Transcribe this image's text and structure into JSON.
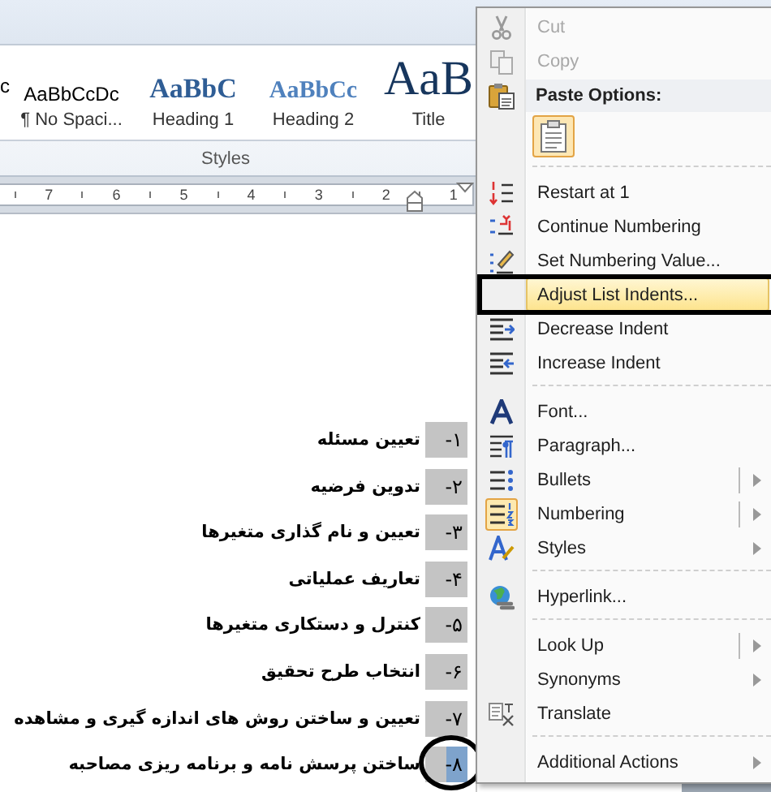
{
  "ribbon": {
    "styles": [
      {
        "sample": "c",
        "kind": "normal"
      },
      {
        "sample": "AaBbCcDc",
        "label": "¶ No Spaci...",
        "kind": "nospacing"
      },
      {
        "sample": "AaBbC",
        "label": "Heading 1",
        "kind": "heading1"
      },
      {
        "sample": "AaBbCc",
        "label": "Heading 2",
        "kind": "heading2"
      },
      {
        "sample": "AaB",
        "label": "Title",
        "kind": "title"
      }
    ],
    "group_label": "Styles"
  },
  "ruler": {
    "marks": [
      "7",
      "6",
      "5",
      "4",
      "3",
      "2",
      "1"
    ]
  },
  "list": [
    {
      "number": "۱-",
      "text": "تعیین مسئله",
      "selected": false,
      "circled": false
    },
    {
      "number": "۲-",
      "text": "تدوین فرضیه",
      "selected": false,
      "circled": false
    },
    {
      "number": "۳-",
      "text": "تعیین و نام گذاری متغیرها",
      "selected": false,
      "circled": false
    },
    {
      "number": "۴-",
      "text": "تعاریف عملیاتی",
      "selected": false,
      "circled": false
    },
    {
      "number": "۵-",
      "text": "کنترل و دستکاری متغیرها",
      "selected": false,
      "circled": false
    },
    {
      "number": "۶-",
      "text": "انتخاب طرح تحقیق",
      "selected": false,
      "circled": false
    },
    {
      "number": "۷-",
      "text": "تعیین و ساختن روش های اندازه گیری و مشاهده",
      "selected": false,
      "circled": false
    },
    {
      "number": "۸-",
      "text": "ساختن پرسش نامه و برنامه ریزی مصاحبه",
      "selected": true,
      "circled": true
    }
  ],
  "context_menu": [
    {
      "kind": "command",
      "label": "Cut",
      "disabled": true
    },
    {
      "kind": "command",
      "label": "Copy",
      "disabled": true
    },
    {
      "kind": "header",
      "label": "Paste Options:"
    },
    {
      "kind": "paste"
    },
    {
      "kind": "separator"
    },
    {
      "kind": "command",
      "label": "Restart at 1"
    },
    {
      "kind": "command",
      "label": "Continue Numbering"
    },
    {
      "kind": "command",
      "label": "Set Numbering Value..."
    },
    {
      "kind": "command",
      "label": "Adjust List Indents...",
      "highlighted": true,
      "outlined": true
    },
    {
      "kind": "command",
      "label": "Decrease Indent"
    },
    {
      "kind": "command",
      "label": "Increase Indent"
    },
    {
      "kind": "separator"
    },
    {
      "kind": "command",
      "label": "Font..."
    },
    {
      "kind": "command",
      "label": "Paragraph..."
    },
    {
      "kind": "command",
      "label": "Bullets",
      "submenu": true,
      "split": true
    },
    {
      "kind": "command",
      "label": "Numbering",
      "submenu": true,
      "split": true,
      "icon_active": true
    },
    {
      "kind": "command",
      "label": "Styles",
      "submenu": true
    },
    {
      "kind": "separator"
    },
    {
      "kind": "command",
      "label": "Hyperlink..."
    },
    {
      "kind": "separator"
    },
    {
      "kind": "command",
      "label": "Look Up",
      "submenu": true,
      "split": true
    },
    {
      "kind": "command",
      "label": "Synonyms",
      "submenu": true
    },
    {
      "kind": "command",
      "label": "Translate"
    },
    {
      "kind": "separator"
    },
    {
      "kind": "command",
      "label": "Additional Actions",
      "submenu": true
    }
  ]
}
